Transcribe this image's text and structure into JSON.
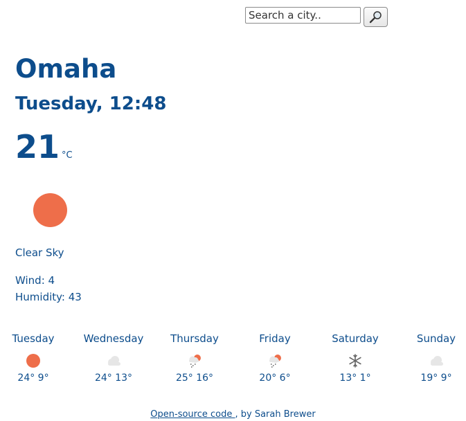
{
  "search": {
    "placeholder": "Search a city..",
    "button_icon": "magnifier-icon"
  },
  "city": "Omaha",
  "datetime": "Tuesday, 12:48",
  "current": {
    "temperature": "21",
    "unit": "°C",
    "icon": "sun-icon",
    "description": "Clear Sky",
    "wind": "Wind: 4",
    "humidity": "Humidity: 43"
  },
  "forecast": [
    {
      "day": "Tuesday",
      "icon": "sun-icon",
      "temps": "24° 9°"
    },
    {
      "day": "Wednesday",
      "icon": "cloud-icon",
      "temps": "24° 13°"
    },
    {
      "day": "Thursday",
      "icon": "rain-sun-icon",
      "temps": "25° 16°"
    },
    {
      "day": "Friday",
      "icon": "rain-sun-icon",
      "temps": "20° 6°"
    },
    {
      "day": "Saturday",
      "icon": "snowflake-icon",
      "temps": "13° 1°"
    },
    {
      "day": "Sunday",
      "icon": "cloud-icon",
      "temps": "19° 9°"
    }
  ],
  "footer": {
    "link_text": "Open-source code ",
    "suffix": ", by Sarah Brewer"
  },
  "colors": {
    "text": "#0d4d8c",
    "sun": "#ee6e4a",
    "cloud": "#e6e6e6"
  }
}
